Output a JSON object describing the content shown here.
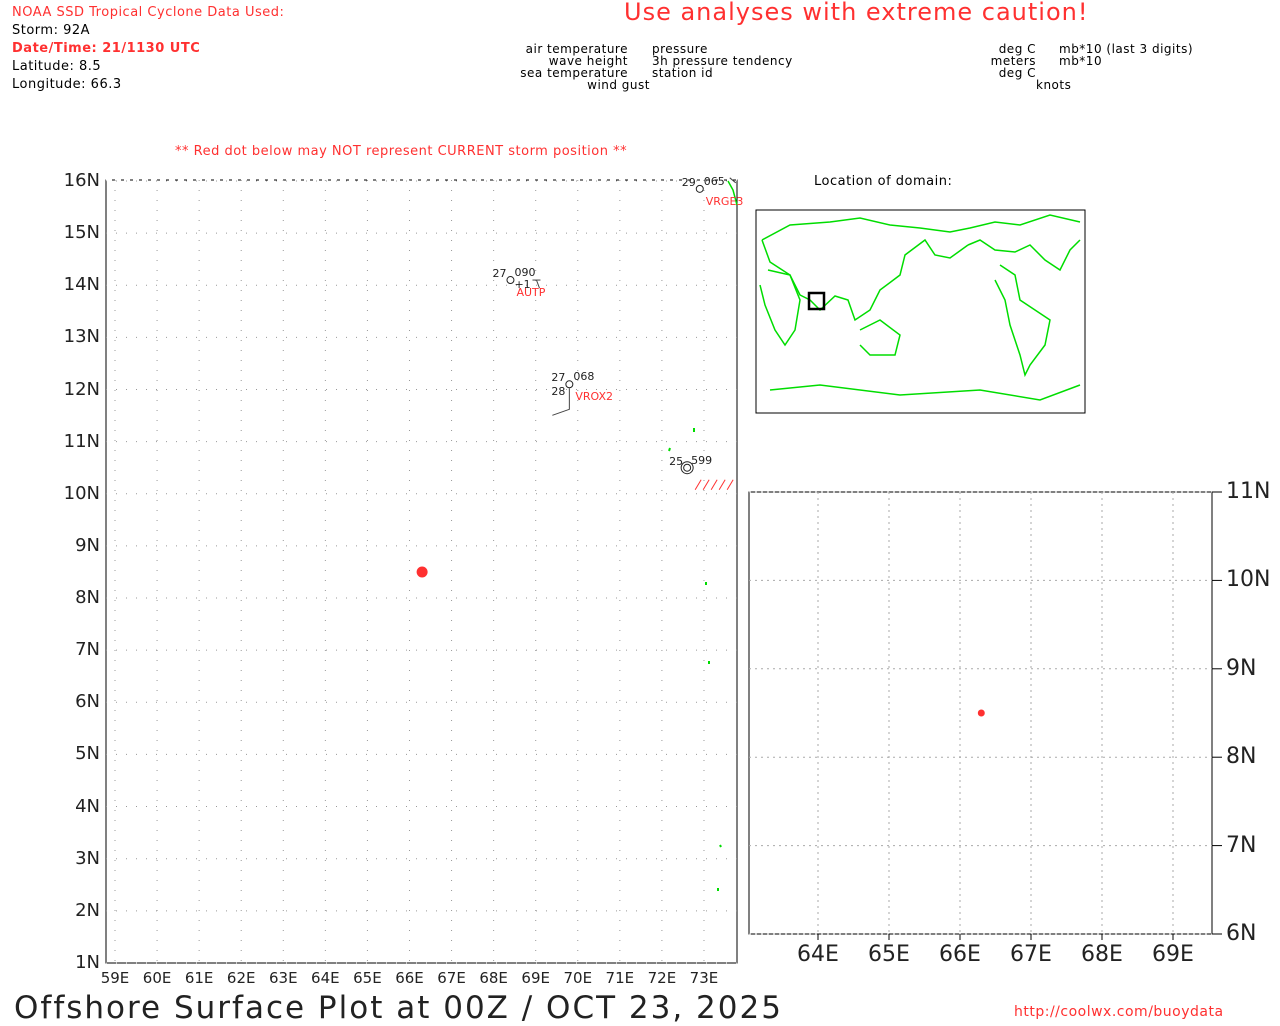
{
  "header": {
    "source": "NOAA SSD Tropical Cyclone Data Used:",
    "storm": "Storm: 92A",
    "datetime": "Date/Time: 21/1130 UTC",
    "latitude": "Latitude: 8.5",
    "longitude": "Longitude: 66.3",
    "caution": "Use  analyses  with  extreme  caution!"
  },
  "legend": {
    "left": [
      "air temperature",
      "wave height",
      "sea temperature",
      "wind gust"
    ],
    "right": [
      "pressure",
      "3h pressure tendency",
      "station id"
    ],
    "units_left": [
      "deg C",
      "meters",
      "deg C",
      "knots"
    ],
    "units_right": [
      "mb*10 (last 3 digits)",
      "mb*10"
    ]
  },
  "warning": "** Red dot below may NOT represent CURRENT storm position **",
  "storm_position": {
    "lat": 8.5,
    "lon": 66.3,
    "color": "#ff3030"
  },
  "main_map": {
    "lat_labels": [
      "16N",
      "15N",
      "14N",
      "13N",
      "12N",
      "11N",
      "10N",
      "9N",
      "8N",
      "7N",
      "6N",
      "5N",
      "4N",
      "3N",
      "2N",
      "1N"
    ],
    "lon_labels": [
      "59E",
      "60E",
      "61E",
      "62E",
      "63E",
      "64E",
      "65E",
      "66E",
      "67E",
      "68E",
      "69E",
      "70E",
      "71E",
      "72E",
      "73E"
    ]
  },
  "stations": [
    {
      "id": "VRGE3",
      "lat": 15.85,
      "lon": 72.9,
      "air": "29",
      "pressure": "065"
    },
    {
      "id": "AUTP",
      "lat": 14.1,
      "lon": 68.4,
      "air": "27",
      "pressure": "090",
      "tendency": "+1"
    },
    {
      "id": "VROX2",
      "lat": 12.1,
      "lon": 69.8,
      "air": "27",
      "pressure": "068",
      "sea": "28"
    },
    {
      "id": "",
      "lat": 10.5,
      "lon": 72.6,
      "air": "25",
      "pressure": "599"
    }
  ],
  "locator": {
    "title": "Location of domain:"
  },
  "inset_map": {
    "lat_labels": [
      "11N",
      "10N",
      "9N",
      "8N",
      "7N",
      "6N"
    ],
    "lon_labels": [
      "64E",
      "65E",
      "66E",
      "67E",
      "68E",
      "69E"
    ]
  },
  "footer": {
    "title": "Offshore  Surface  Plot  at  00Z  /  OCT  23,  2025",
    "url": "http://coolwx.com/buoydata"
  }
}
